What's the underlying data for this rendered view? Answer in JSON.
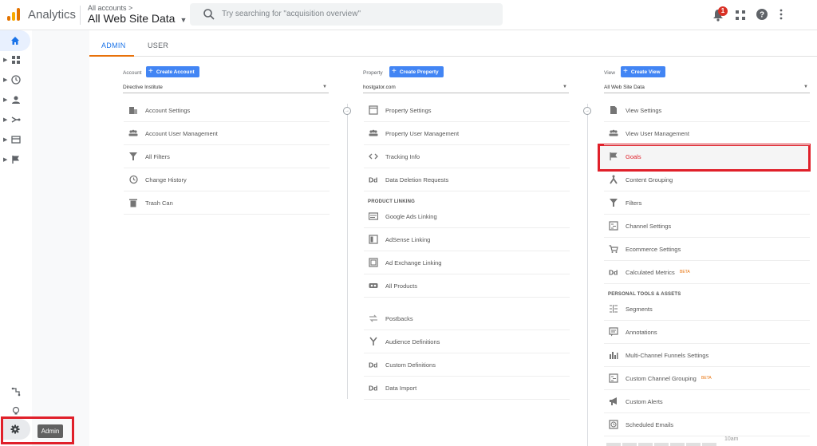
{
  "topbar": {
    "app_name": "Analytics",
    "account_crumb": "All accounts >",
    "view_name": "All Web Site Data",
    "search_placeholder": "Try searching for \"acquisition overview\"",
    "notification_count": "1"
  },
  "tabs": {
    "admin": "ADMIN",
    "user": "USER"
  },
  "account_col": {
    "label": "Account",
    "create_label": "Create Account",
    "selected": "Directive Institute",
    "items": [
      {
        "label": "Account Settings",
        "icon": "building-icon"
      },
      {
        "label": "Account User Management",
        "icon": "users-icon"
      },
      {
        "label": "All Filters",
        "icon": "filter-icon"
      },
      {
        "label": "Change History",
        "icon": "history-icon"
      },
      {
        "label": "Trash Can",
        "icon": "trash-icon"
      }
    ]
  },
  "property_col": {
    "label": "Property",
    "create_label": "Create Property",
    "selected": "hostgator.com",
    "items": [
      {
        "label": "Property Settings",
        "icon": "window-icon"
      },
      {
        "label": "Property User Management",
        "icon": "users-icon"
      },
      {
        "label": "Tracking Info",
        "icon": "code-icon"
      },
      {
        "label": "Data Deletion Requests",
        "icon": "dd-icon"
      }
    ],
    "section": "PRODUCT LINKING",
    "linking": [
      {
        "label": "Google Ads Linking",
        "icon": "ads-icon"
      },
      {
        "label": "AdSense Linking",
        "icon": "adsense-icon"
      },
      {
        "label": "Ad Exchange Linking",
        "icon": "adexchange-icon"
      },
      {
        "label": "All Products",
        "icon": "link-icon"
      }
    ],
    "more": [
      {
        "label": "Postbacks",
        "icon": "postback-icon"
      },
      {
        "label": "Audience Definitions",
        "icon": "audience-icon"
      },
      {
        "label": "Custom Definitions",
        "icon": "dd-icon"
      },
      {
        "label": "Data Import",
        "icon": "dd-icon"
      }
    ]
  },
  "view_col": {
    "label": "View",
    "create_label": "Create View",
    "selected": "All Web Site Data",
    "items": [
      {
        "label": "View Settings",
        "icon": "document-icon"
      },
      {
        "label": "View User Management",
        "icon": "users-icon"
      },
      {
        "label": "Goals",
        "icon": "flag-icon"
      },
      {
        "label": "Content Grouping",
        "icon": "content-grouping-icon"
      },
      {
        "label": "Filters",
        "icon": "filter-icon"
      },
      {
        "label": "Channel Settings",
        "icon": "channel-icon"
      },
      {
        "label": "Ecommerce Settings",
        "icon": "cart-icon"
      },
      {
        "label": "Calculated Metrics",
        "icon": "dd-icon",
        "badge": "BETA"
      }
    ],
    "section": "PERSONAL TOOLS & ASSETS",
    "personal": [
      {
        "label": "Segments",
        "icon": "segments-icon"
      },
      {
        "label": "Annotations",
        "icon": "annotation-icon"
      },
      {
        "label": "Multi-Channel Funnels Settings",
        "icon": "bars-icon"
      },
      {
        "label": "Custom Channel Grouping",
        "icon": "channel-icon",
        "badge": "BETA"
      },
      {
        "label": "Custom Alerts",
        "icon": "megaphone-icon"
      },
      {
        "label": "Scheduled Emails",
        "icon": "clock-icon"
      }
    ]
  },
  "tooltip": "Admin",
  "time_label": "10am",
  "colors": {
    "accent": "#1a73e8",
    "button": "#4285f4",
    "highlight": "#e0202a",
    "tab_underline": "#e8710a"
  }
}
